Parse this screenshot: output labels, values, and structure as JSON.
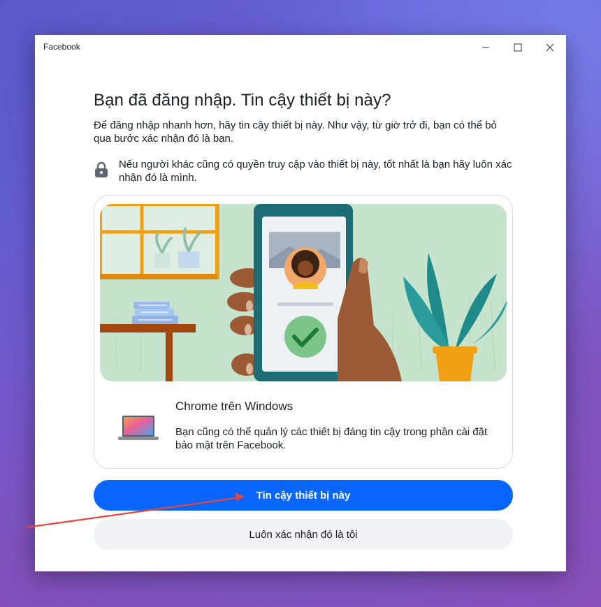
{
  "window": {
    "title": "Facebook"
  },
  "dialog": {
    "heading": "Bạn đã đăng nhập. Tin cậy thiết bị này?",
    "subtitle": "Để đăng nhập nhanh hơn, hãy tin cậy thiết bị này. Như vậy, từ giờ trở đi, bạn có thể bỏ qua bước xác nhận đó là bạn.",
    "note": "Nếu người khác cũng có quyền truy cập vào thiết bị này, tốt nhất là bạn hãy luôn xác nhận đó là mình.",
    "device_title": "Chrome trên Windows",
    "device_desc": "Bạn cũng có thể quản lý các thiết bị đáng tin cậy trong phần cài đặt bảo mật trên Facebook.",
    "primary_button": "Tin cậy thiết bị này",
    "secondary_button": "Luôn xác nhận đó là tôi"
  },
  "colors": {
    "primary": "#0866ff",
    "secondary_bg": "#f0f2f5",
    "arrow": "#e8453c"
  },
  "icons": [
    "minimize-icon",
    "maximize-icon",
    "close-icon",
    "lock-icon",
    "laptop-icon",
    "checkmark-icon"
  ]
}
